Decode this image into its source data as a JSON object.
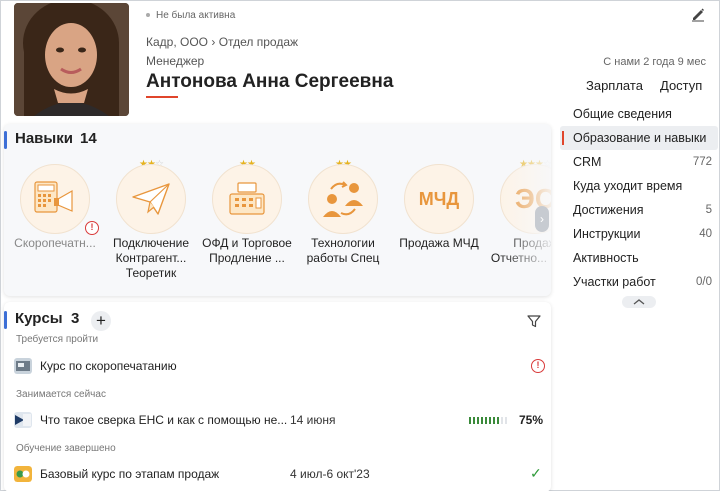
{
  "header": {
    "status": "Не была активна",
    "org": "Кадр, ООО",
    "department": "Отдел продаж",
    "position": "Менеджер",
    "fullname": "Антонова Анна Сергеевна",
    "tenure": "С нами 2 года 9 мес",
    "salary_link": "Зарплата",
    "access_link": "Доступ"
  },
  "nav": {
    "items": [
      {
        "label": "Общие сведения",
        "count": ""
      },
      {
        "label": "Образование и навыки",
        "count": ""
      },
      {
        "label": "CRM",
        "count": "772"
      },
      {
        "label": "Куда уходит время",
        "count": ""
      },
      {
        "label": "Достижения",
        "count": "5"
      },
      {
        "label": "Инструкции",
        "count": "40"
      },
      {
        "label": "Активность",
        "count": ""
      },
      {
        "label": "Участки работ",
        "count": "0/0"
      }
    ]
  },
  "skills": {
    "title": "Навыки",
    "count": "14",
    "items": [
      {
        "label": "Скоропечатн...",
        "stars": 0,
        "warning": true
      },
      {
        "label": "Подключение Контрагент... Теоретик",
        "stars": 2
      },
      {
        "label": "ОФД и Торговое Продление ...",
        "stars": 2
      },
      {
        "label": "Технологии работы Спец",
        "stars": 2
      },
      {
        "label": "Продажа МЧД",
        "stars": 0,
        "icon_text": "МЧД"
      },
      {
        "label": "Продаж Отчетно... Спец",
        "stars": 3,
        "icon_text": "ЭС"
      }
    ]
  },
  "courses": {
    "title": "Курсы",
    "count": "3",
    "add": "+",
    "sections": {
      "required": "Требуется пройти",
      "in_progress": "Занимается сейчас",
      "completed": "Обучение завершено"
    },
    "required": {
      "title": "Курс по скоропечатанию"
    },
    "in_progress": {
      "title": "Что такое сверка ЕНС и как с помощью не...",
      "date": "14 июня",
      "percent": "75%",
      "progress": 0.75
    },
    "completed": {
      "title": "Базовый курс по этапам продаж",
      "date": "4 июл-6 окт'23"
    }
  },
  "colors": {
    "accent": "#e0452b",
    "blue": "#3d6fd6",
    "star": "#e6b21e",
    "icon_orange": "#e8963d",
    "progress": "#3a8a3a",
    "warning": "#d93a3a"
  }
}
